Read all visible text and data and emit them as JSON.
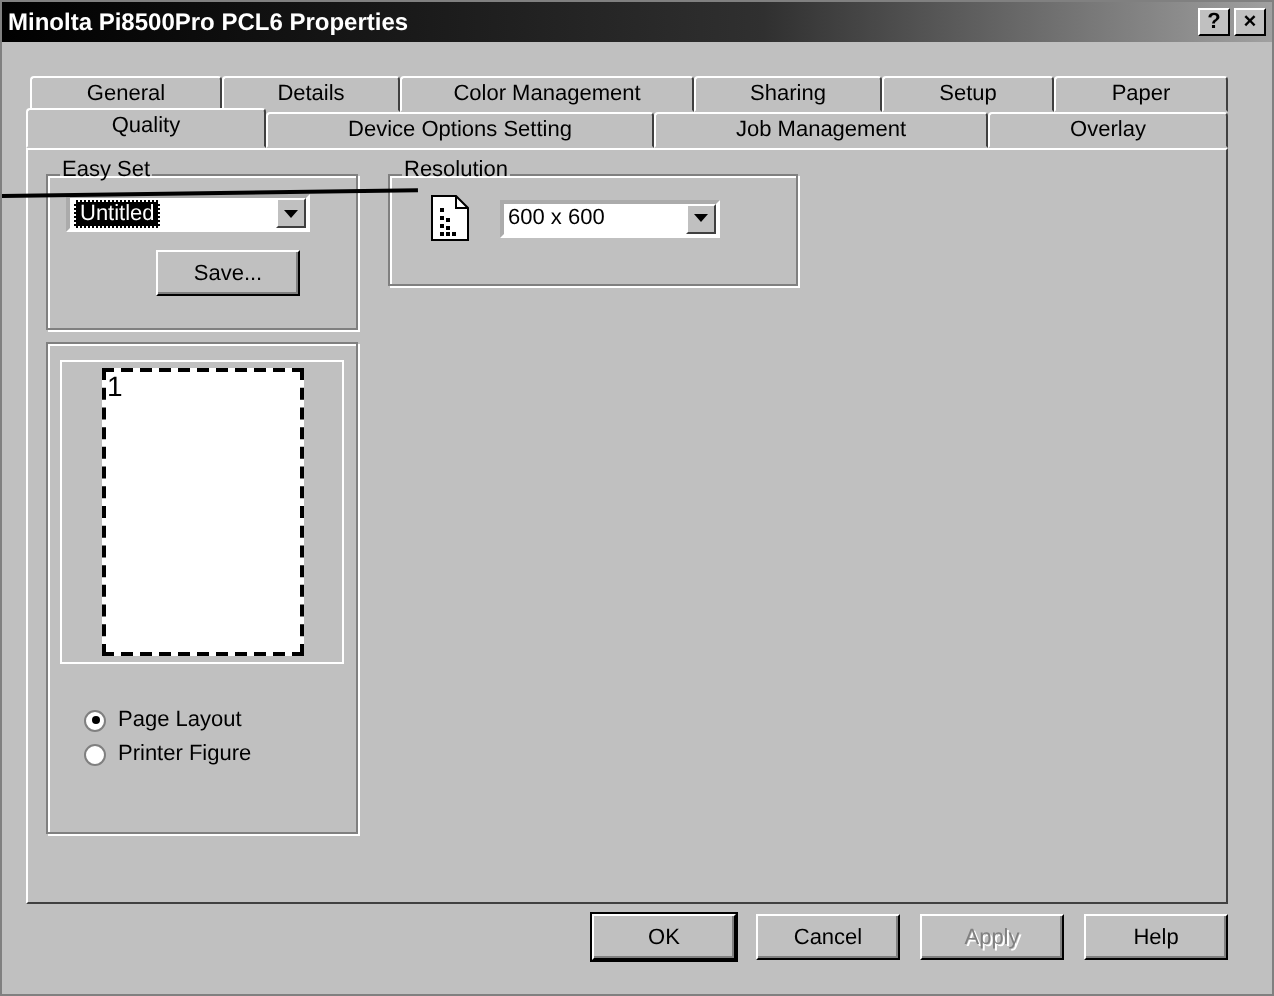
{
  "window": {
    "title": "Minolta Pi8500Pro PCL6 Properties",
    "controls": [
      "?",
      "×"
    ]
  },
  "tab_rows": [
    [
      {
        "label": "General",
        "selected": false
      },
      {
        "label": "Details",
        "selected": false
      },
      {
        "label": "Color Management",
        "selected": false
      },
      {
        "label": "Sharing",
        "selected": false
      },
      {
        "label": "Setup",
        "selected": false
      },
      {
        "label": "Paper",
        "selected": false
      }
    ],
    [
      {
        "label": "Quality",
        "selected": true
      },
      {
        "label": "Device Options Setting",
        "selected": false
      },
      {
        "label": "Job Management",
        "selected": false
      },
      {
        "label": "Overlay",
        "selected": false
      }
    ]
  ],
  "easy_set": {
    "title": "Easy Set",
    "value": "Untitled",
    "button": "Save..."
  },
  "resolution": {
    "title": "Resolution",
    "value": "600 x 600"
  },
  "preview": {
    "page_number": "1",
    "options": [
      {
        "label": "Page Layout",
        "selected": true
      },
      {
        "label": "Printer Figure",
        "selected": false
      }
    ]
  },
  "buttons": [
    {
      "label": "OK",
      "disabled": false,
      "default": true
    },
    {
      "label": "Cancel",
      "disabled": false,
      "default": false
    },
    {
      "label": "Apply",
      "disabled": true,
      "default": false
    },
    {
      "label": "Help",
      "disabled": false,
      "default": false
    }
  ]
}
